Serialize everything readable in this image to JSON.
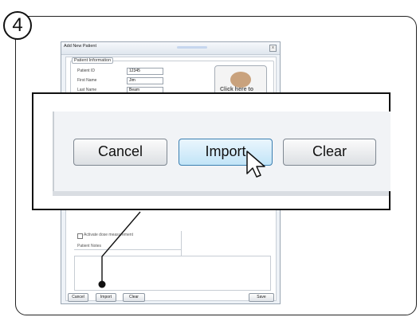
{
  "step": {
    "number": "4"
  },
  "dialog": {
    "title": "Add New Patient",
    "close_label": "x",
    "group_label": "Patient Information",
    "fields": [
      {
        "label": "Patient ID",
        "value": "12345"
      },
      {
        "label": "First Name",
        "value": "Jim"
      },
      {
        "label": "Last Name",
        "value": "Beam"
      }
    ],
    "photo_button_label": "Click here to",
    "dose_checkbox_label": "Activate dose measurement",
    "dose_checkbox_checked": false,
    "notes_label": "Patient Notes",
    "notes_value": "",
    "buttons": {
      "cancel": "Cancel",
      "import": "Import",
      "clear": "Clear",
      "save": "Save"
    }
  },
  "zoom": {
    "buttons": {
      "cancel": "Cancel",
      "import": "Import",
      "clear": "Clear"
    },
    "active_button": "import",
    "cursor_icon": "pointer-cursor-icon"
  },
  "colors": {
    "active_button_border": "#3c7fb1",
    "active_button_fill": "#c2e4f7"
  }
}
